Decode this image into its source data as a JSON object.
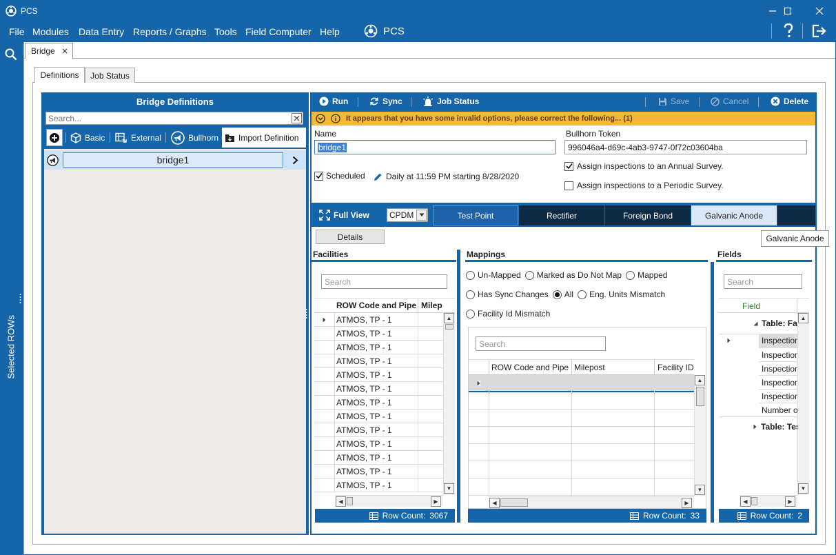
{
  "window": {
    "title": "PCS"
  },
  "menu": {
    "items": [
      "File",
      "Modules",
      "Data Entry",
      "Reports / Graphs",
      "Tools",
      "Field Computer",
      "Help"
    ],
    "brand": "PCS"
  },
  "left_strip": {
    "label": "Selected ROWs"
  },
  "doc_tab": {
    "label": "Bridge"
  },
  "sub_tabs": [
    "Definitions",
    "Job Status"
  ],
  "definitions": {
    "title": "Bridge Definitions",
    "search_placeholder": "Search...",
    "toolbar": {
      "basic": "Basic",
      "external": "External",
      "bullhorn": "Bullhorn",
      "import": "Import Definition"
    },
    "items": [
      "bridge1"
    ]
  },
  "main_toolbar": {
    "run": "Run",
    "sync": "Sync",
    "job_status": "Job Status",
    "save": "Save",
    "cancel": "Cancel",
    "delete": "Delete"
  },
  "warning": "It appears that you have some invalid options, please correct the following... (1)",
  "options": {
    "name_label": "Name",
    "name_value": "bridge1",
    "token_label": "Bullhorn Token",
    "token_value": "996046a4-d69c-4ab3-9747-0f72c03604ba",
    "scheduled_label": "Scheduled",
    "schedule_text": "Daily at 11:59 PM starting 8/28/2020",
    "annual_label": "Assign inspections to an Annual Survey.",
    "periodic_label": "Assign inspections to a Periodic Survey."
  },
  "category_bar": {
    "full_view": "Full View",
    "dropdown_value": "CPDM",
    "tabs": [
      "Test Point",
      "Rectifier",
      "Foreign Bond",
      "Galvanic Anode"
    ],
    "tooltip": "Galvanic Anode"
  },
  "details_button": "Details",
  "facilities": {
    "title": "Facilities",
    "search_placeholder": "Search",
    "columns": [
      "ROW Code and Pipe",
      "Milep"
    ],
    "rows": [
      "ATMOS, TP - 1",
      "ATMOS, TP - 1",
      "ATMOS, TP - 1",
      "ATMOS, TP - 1",
      "ATMOS, TP - 1",
      "ATMOS, TP - 1",
      "ATMOS, TP - 1",
      "ATMOS, TP - 1",
      "ATMOS, TP - 1",
      "ATMOS, TP - 1",
      "ATMOS, TP - 1",
      "ATMOS, TP - 1",
      "ATMOS, TP - 1"
    ],
    "row_count_label": "Row Count:",
    "row_count": "3067"
  },
  "mappings": {
    "title": "Mappings",
    "filters": [
      "Un-Mapped",
      "Marked as Do Not Map",
      "Mapped",
      "Has Sync Changes",
      "All",
      "Eng. Units Mismatch",
      "Facility Id Mismatch"
    ],
    "selected_filter": "All",
    "search_placeholder": "Search",
    "columns": [
      "ROW Code and Pipe",
      "Milepost",
      "Facility ID"
    ],
    "row_count_label": "Row Count:",
    "row_count": "33"
  },
  "fields": {
    "title": "Fields",
    "search_placeholder": "Search",
    "column": "Field",
    "groups": [
      "Table: Fac",
      "Table: Tes"
    ],
    "items": [
      "Inspection",
      "Inspection",
      "Inspection",
      "Inspection",
      "Inspection",
      "Number o"
    ],
    "row_count_label": "Row Count:",
    "row_count": "2"
  },
  "colors": {
    "accent": "#1565a8",
    "warning": "#f5b63c",
    "dark_tab": "#0e2a44",
    "selected_tab": "#1e63aa"
  }
}
